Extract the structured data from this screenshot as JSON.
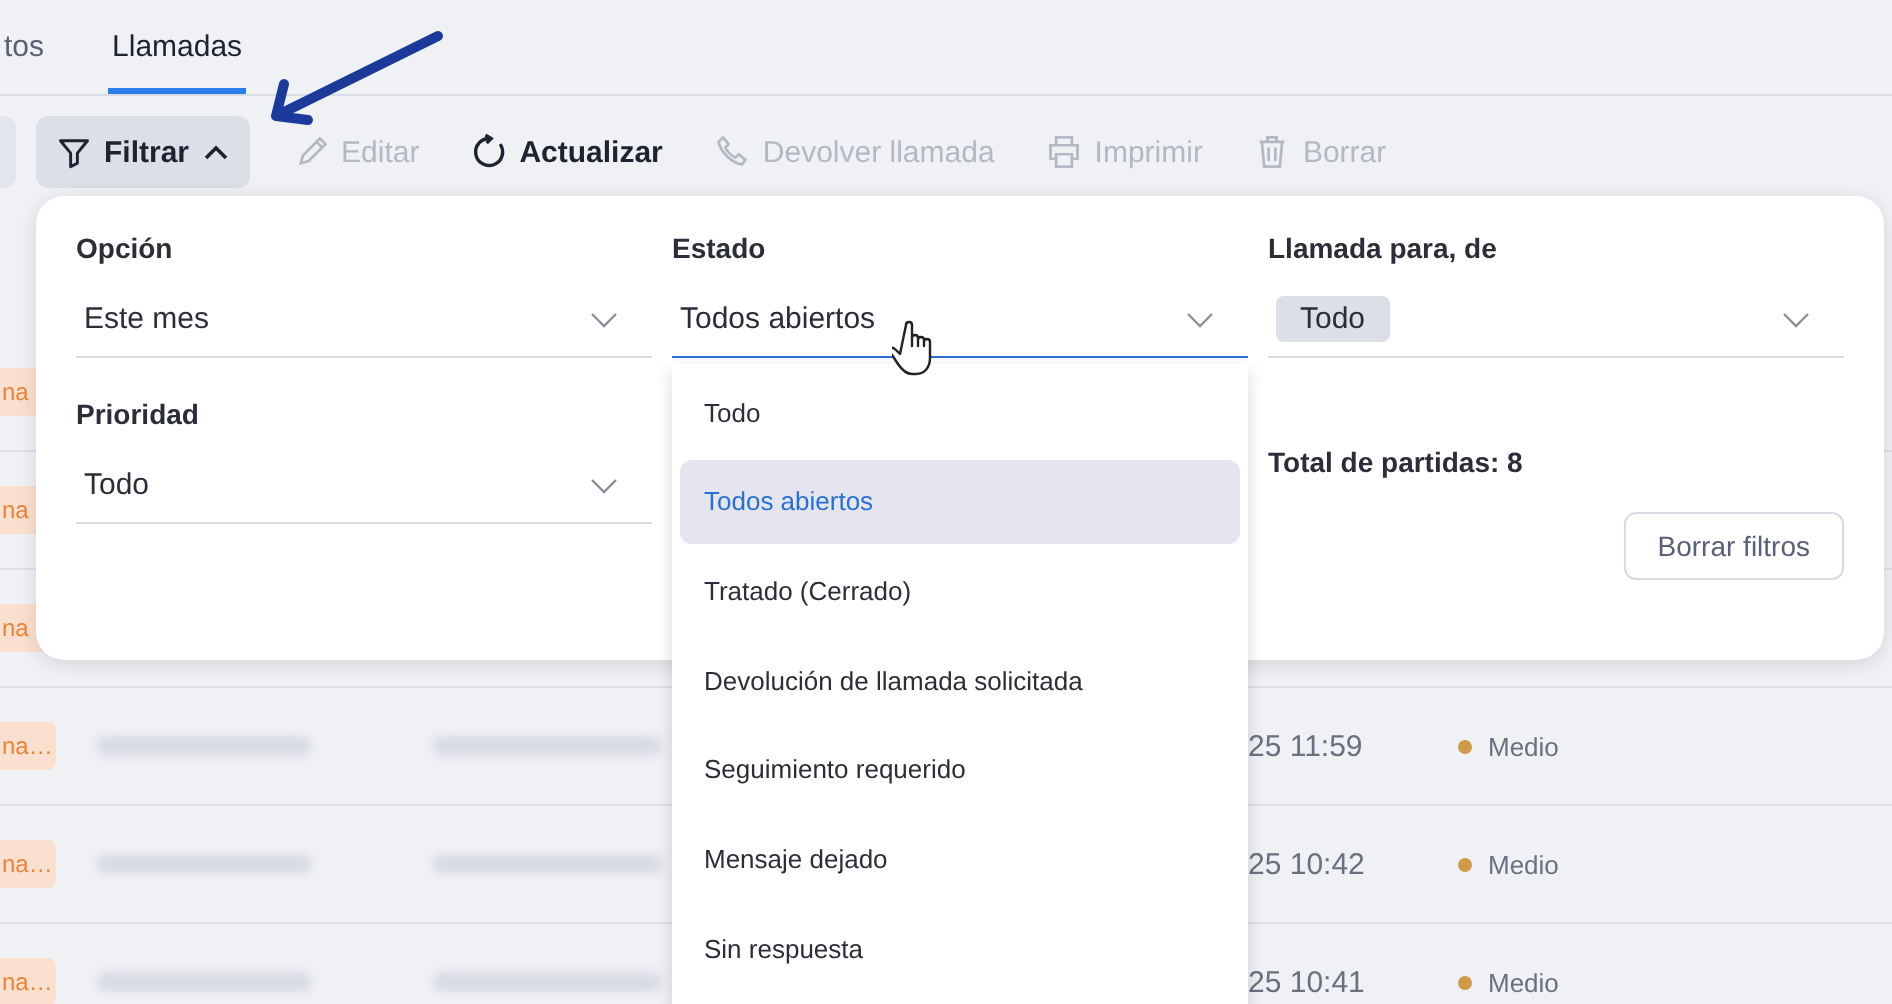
{
  "tabs": [
    {
      "label": "tos",
      "selected": false
    },
    {
      "label": "Llamadas",
      "selected": true
    }
  ],
  "toolbar": [
    {
      "label": "Filtrar",
      "kind": "filter",
      "disabled": false,
      "expanded": true
    },
    {
      "label": "Editar",
      "kind": "edit",
      "disabled": true
    },
    {
      "label": "Actualizar",
      "kind": "refresh",
      "disabled": false
    },
    {
      "label": "Devolver llamada",
      "kind": "phone",
      "disabled": true
    },
    {
      "label": "Imprimir",
      "kind": "print",
      "disabled": true
    },
    {
      "label": "Borrar",
      "kind": "trash",
      "disabled": true
    }
  ],
  "filters": {
    "fields": [
      {
        "label": "Opción",
        "value": "Este mes",
        "expanded": false
      },
      {
        "label": "Estado",
        "value": "Todos abiertos",
        "expanded": true
      },
      {
        "label": "Llamada para, de",
        "chip": "Todo",
        "expanded": false
      },
      {
        "label": "Prioridad",
        "value": "Todo",
        "expanded": false
      }
    ],
    "total": "Total de partidas: 8",
    "clear_button": "Borrar filtros"
  },
  "dropdown": [
    {
      "label": "Todo",
      "selected": false
    },
    {
      "label": "Todos abiertos",
      "selected": true
    },
    {
      "label": "Tratado (Cerrado)",
      "selected": false
    },
    {
      "label": "Devolución de llamada solicitada",
      "selected": false
    },
    {
      "label": "Seguimiento requerido",
      "selected": false
    },
    {
      "label": "Mensaje dejado",
      "selected": false
    },
    {
      "label": "Sin respuesta",
      "selected": false
    }
  ],
  "table": {
    "rows": [
      {
        "badge": "na"
      },
      {
        "badge": "na"
      },
      {
        "badge": "na"
      },
      {
        "badge": "na…",
        "time": "25 11:59",
        "priority": "Medio",
        "color": "#d09a4a"
      },
      {
        "badge": "na…",
        "time": "25 10:42",
        "priority": "Medio",
        "color": "#d09a4a"
      },
      {
        "badge": "na…",
        "time": "25 10:41",
        "priority": "Medio",
        "color": "#d09a4a"
      }
    ]
  }
}
